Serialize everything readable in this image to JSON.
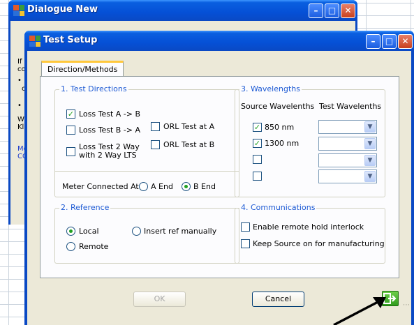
{
  "background_window": {
    "title": "Dialogue New",
    "text_fragments": [
      "If y",
      "co",
      "• I",
      "c",
      "• 1",
      "W",
      "Kl",
      "Me",
      "CO"
    ]
  },
  "dialog": {
    "title": "Test Setup",
    "tab_label": "Direction/Methods",
    "test_directions": {
      "legend": "1. Test Directions",
      "loss_a_b": "Loss Test A -> B",
      "loss_b_a": "Loss Test B -> A",
      "loss_2way_line1": "Loss Test 2 Way",
      "loss_2way_line2": "with 2 Way LTS",
      "orl_a": "ORL Test at A",
      "orl_b": "ORL Test at B"
    },
    "meter": {
      "label": "Meter  Connected At",
      "a_end": "A End",
      "b_end": "B End"
    },
    "wavelengths": {
      "legend": "3. Wavelengths",
      "source_header": "Source Wavelenths",
      "test_header": "Test Wavelenths",
      "wl1": "850 nm",
      "wl2": "1300 nm"
    },
    "reference": {
      "legend": "2. Reference",
      "local": "Local",
      "remote": "Remote",
      "insert_manual": "Insert ref manually"
    },
    "communications": {
      "legend": "4. Communications",
      "remote_hold": "Enable remote hold interlock",
      "keep_source": "Keep Source on for manufacturing"
    },
    "ok_label": "OK",
    "cancel_label": "Cancel"
  },
  "colors": {
    "xp_blue": "#0a49c4",
    "dialog_face": "#ece9d8",
    "legend_blue": "#1e5bd4",
    "check_green": "#21a121"
  }
}
